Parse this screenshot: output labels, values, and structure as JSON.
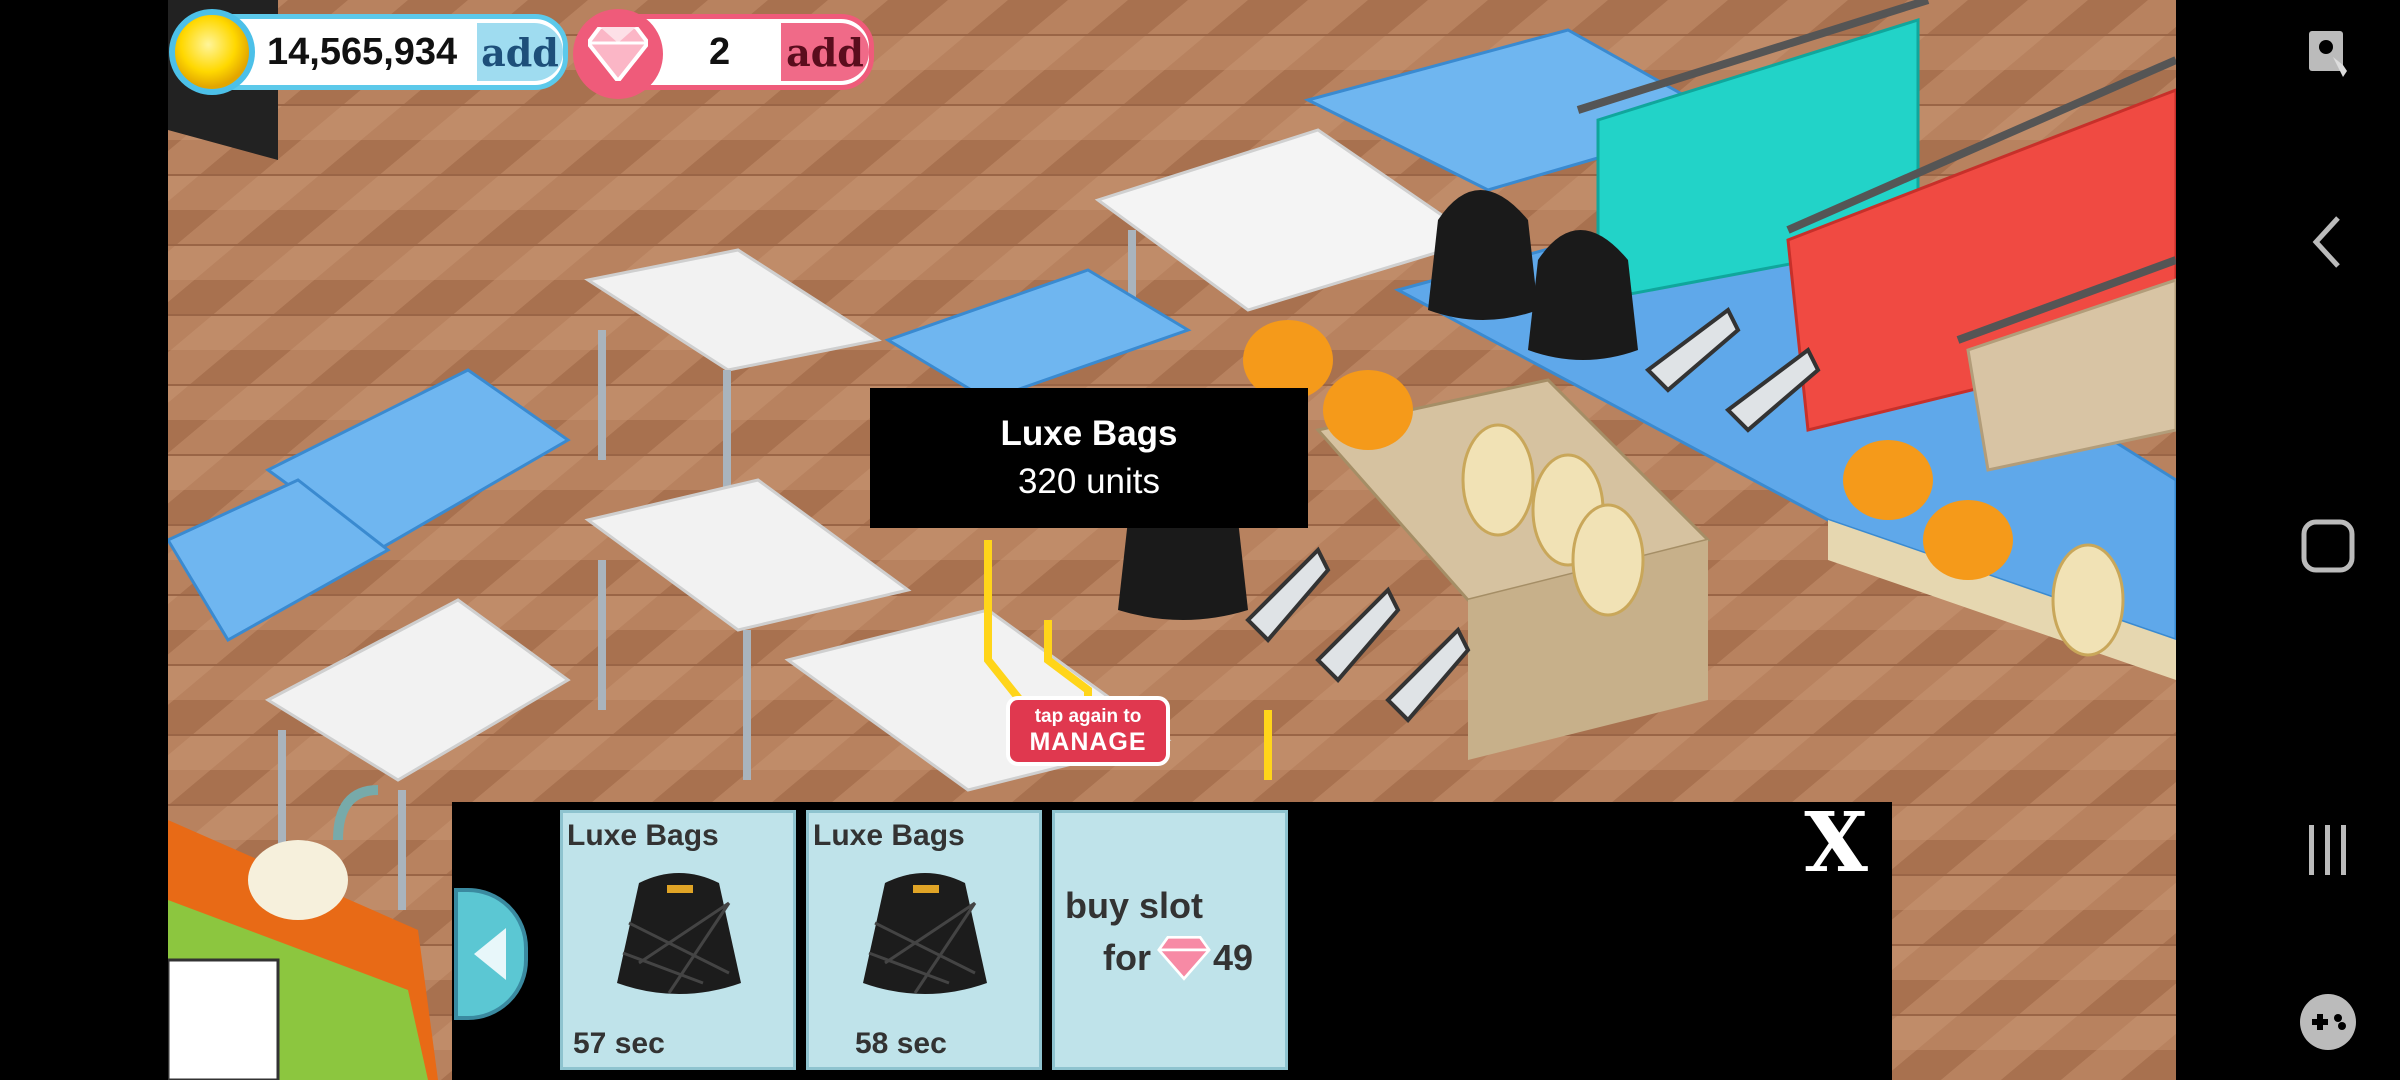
{
  "hud": {
    "coins": "14,565,934",
    "coins_add": "add",
    "gems": "2",
    "gems_add": "add"
  },
  "tooltip": {
    "item_name": "Luxe Bags",
    "units": "320 units"
  },
  "manage_button": {
    "line1": "tap again to",
    "line2": "MANAGE"
  },
  "panel": {
    "slots": [
      {
        "name": "Luxe Bags",
        "time": "57 sec",
        "icon": "black-quilted-bag-icon"
      },
      {
        "name": "Luxe Bags",
        "time": "58 sec",
        "icon": "black-quilted-bag-icon"
      }
    ],
    "buy_slot": {
      "line1": "buy slot",
      "line2_prefix": "for",
      "price": "49",
      "icon": "gem-icon"
    },
    "close_label": "X"
  },
  "system_nav": {
    "icons": [
      "screen-capture-icon",
      "back-icon",
      "home-icon",
      "recents-icon",
      "game-launcher-icon"
    ]
  },
  "colors": {
    "coin_border": "#5cc9ea",
    "gem_border": "#ef5b7a",
    "manage_red": "#e0384f",
    "slot_bg": "#bfe3ea"
  }
}
